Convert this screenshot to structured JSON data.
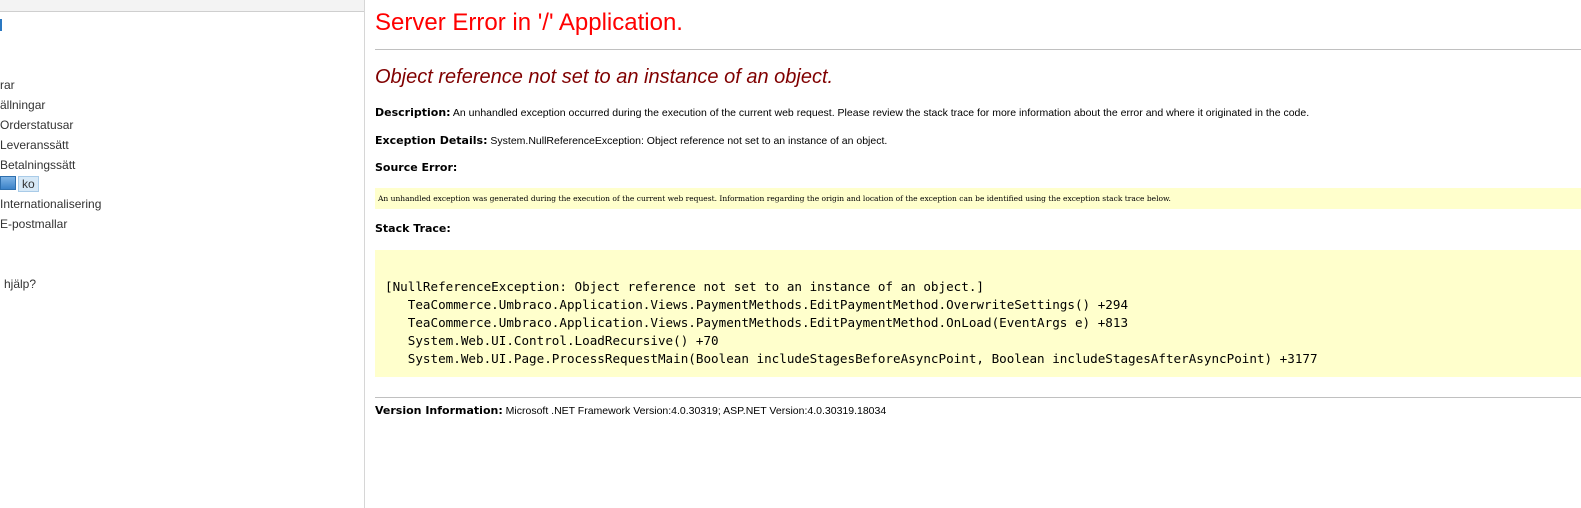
{
  "sidebar": {
    "items": [
      {
        "label": "rar"
      },
      {
        "label": "ällningar"
      },
      {
        "label": "Orderstatusar"
      },
      {
        "label": "Leveranssätt"
      },
      {
        "label": "Betalningssätt"
      },
      {
        "label": "ko",
        "icon": "payment-method-icon",
        "selected": true
      },
      {
        "label": "Internationalisering"
      },
      {
        "label": "E-postmallar"
      }
    ],
    "help": "hjälp?"
  },
  "error": {
    "title": "Server Error in '/' Application.",
    "subtitle": "Object reference not set to an instance of an object.",
    "description_label": "Description:",
    "description_text": " An unhandled exception occurred during the execution of the current web request. Please review the stack trace for more information about the error and where it originated in the code.",
    "exception_label": "Exception Details:",
    "exception_text": " System.NullReferenceException: Object reference not set to an instance of an object.",
    "source_label": "Source Error:",
    "source_text": "An unhandled exception was generated during the execution of the current web request. Information regarding the origin and location of the exception can be identified using the exception stack trace below.",
    "stack_label": "Stack Trace:",
    "stack_lines": [
      "[NullReferenceException: Object reference not set to an instance of an object.]",
      "   TeaCommerce.Umbraco.Application.Views.PaymentMethods.EditPaymentMethod.OverwriteSettings() +294",
      "   TeaCommerce.Umbraco.Application.Views.PaymentMethods.EditPaymentMethod.OnLoad(EventArgs e) +813",
      "   System.Web.UI.Control.LoadRecursive() +70",
      "   System.Web.UI.Page.ProcessRequestMain(Boolean includeStagesBeforeAsyncPoint, Boolean includeStagesAfterAsyncPoint) +3177"
    ],
    "version_label": "Version Information:",
    "version_text": " Microsoft .NET Framework Version:4.0.30319; ASP.NET Version:4.0.30319.18034"
  },
  "colors": {
    "title": "#ff0000",
    "subtitle": "#800000",
    "code_background": "#ffffcc"
  }
}
